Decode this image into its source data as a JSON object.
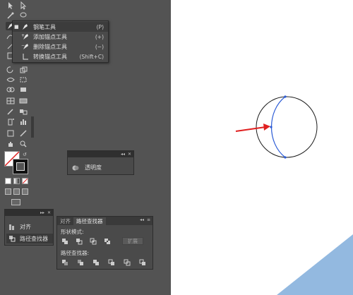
{
  "flyout": {
    "items": [
      {
        "label": "钢笔工具",
        "shortcut": "(P)",
        "selected": true
      },
      {
        "label": "添加锚点工具",
        "shortcut": "(+)"
      },
      {
        "label": "删除锚点工具",
        "shortcut": "(−)"
      },
      {
        "label": "转换锚点工具",
        "shortcut": "(Shift+C)"
      }
    ]
  },
  "transparency_panel": {
    "label": "透明度"
  },
  "align_panel": {
    "items": [
      {
        "label": "对齐"
      },
      {
        "label": "路径查找器"
      }
    ]
  },
  "pathfinder_panel": {
    "tabs": [
      {
        "label": "对齐"
      },
      {
        "label": "路径查找器",
        "active": true
      }
    ],
    "shape_modes_label": "形状模式:",
    "pathfinders_label": "路径查找器:",
    "expand_label": "扩展"
  },
  "colors": {
    "workspace_bg": "#535353",
    "panel_bg": "#4a4a4a",
    "canvas_bg": "#ffffff",
    "arrow": "#e02020",
    "path_stroke": "#2b5bd6"
  }
}
